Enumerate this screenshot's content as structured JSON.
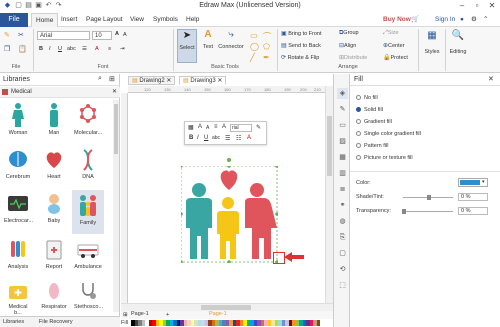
{
  "window": {
    "title": "Edraw Max (Unlicensed Version)"
  },
  "menu": {
    "file": "File",
    "items": [
      "Home",
      "Insert",
      "Page Layout",
      "View",
      "Symbols",
      "Help"
    ],
    "buy_now": "Buy Now",
    "sign_in": "Sign In"
  },
  "ribbon": {
    "font_name": "Arial",
    "font_size": "10",
    "groups": {
      "file": "File",
      "font": "Font",
      "basic_tools": "Basic Tools",
      "arrange": "Arrange"
    },
    "tools": {
      "select": "Select",
      "text": "Text",
      "connector": "Connector"
    },
    "arrange": {
      "bring_to_front": "Bring to Front",
      "send_to_back": "Send to Back",
      "rotate_flip": "Rotate & Flip",
      "group": "Group",
      "align": "Align",
      "distribute": "Distribute",
      "size": "Size",
      "center": "Center",
      "protect": "Protect"
    },
    "styles": "Styles",
    "editing": "Editing"
  },
  "libraries": {
    "title": "Libraries",
    "category": "Medical",
    "items": [
      [
        "Woman",
        "Man",
        "Molecular..."
      ],
      [
        "Cerebrum",
        "Heart",
        "DNA"
      ],
      [
        "Electrocar...",
        "Baby",
        "Family"
      ],
      [
        "Analysis",
        "Report",
        "Ambulance"
      ],
      [
        "Medical b...",
        "Respirator",
        "Stethosco..."
      ]
    ],
    "selected": "Family",
    "bottom_tabs": [
      "Libraries",
      "File Recovery"
    ]
  },
  "canvas": {
    "tabs": [
      "Drawing2",
      "Drawing3"
    ],
    "active_tab": "Drawing3",
    "ruler_numbers": [
      "120",
      "130",
      "140",
      "150",
      "160",
      "170",
      "180",
      "190",
      "200",
      "210"
    ],
    "float_font": "rial",
    "float_labels": {
      "a_big": "A",
      "a_small": "A",
      "bold": "B",
      "italic": "I",
      "underline": "U",
      "abc": "abc"
    },
    "page_tabs": [
      "Page-1",
      "Page-1"
    ],
    "fill_label": "Fill"
  },
  "fill_panel": {
    "title": "Fill",
    "options": [
      "No fill",
      "Solid fill",
      "Gradient fill",
      "Single color gradient fill",
      "Pattern fill",
      "Picture or texture fill"
    ],
    "selected": "Solid fill",
    "color_label": "Color:",
    "color_value": "#2e8fcf",
    "shade_label": "Shade/Tint:",
    "shade_value": "0 %",
    "transparency_label": "Transparency:",
    "transparency_value": "0 %"
  },
  "colors": {
    "accent": "#2b579a",
    "buy": "#c0504d",
    "teal": "#3aa6a4",
    "yellow": "#f5c518",
    "pink": "#e0555b"
  },
  "palette": [
    "#000000",
    "#3f3f3f",
    "#7f7f7f",
    "#bfbfbf",
    "#ffffff",
    "#c00000",
    "#ff0000",
    "#ffc000",
    "#ffff00",
    "#92d050",
    "#00b050",
    "#00b0f0",
    "#0070c0",
    "#002060",
    "#7030a0",
    "#e6b8b7",
    "#fcd5b4",
    "#ffff99",
    "#d8e4bc",
    "#b7dee8",
    "#c5d9f1",
    "#ccc0da",
    "#953735",
    "#e26b0a",
    "#9bbb59",
    "#4bacc6",
    "#4f81bd",
    "#8064a2",
    "#f79646",
    "#1f497d",
    "#ee1c25",
    "#ff7f27",
    "#fff200",
    "#22b14c",
    "#00a2e8",
    "#3f48cc",
    "#a349a4",
    "#b97a57",
    "#ffaec9",
    "#ffc90e",
    "#efe4b0",
    "#b5e61d",
    "#99d9ea",
    "#7092be",
    "#c8bfe7",
    "#880015",
    "#f7941d",
    "#8dc73f",
    "#00a99d",
    "#0072bc",
    "#662d91",
    "#ed145b",
    "#c69c6d",
    "#754c24"
  ]
}
